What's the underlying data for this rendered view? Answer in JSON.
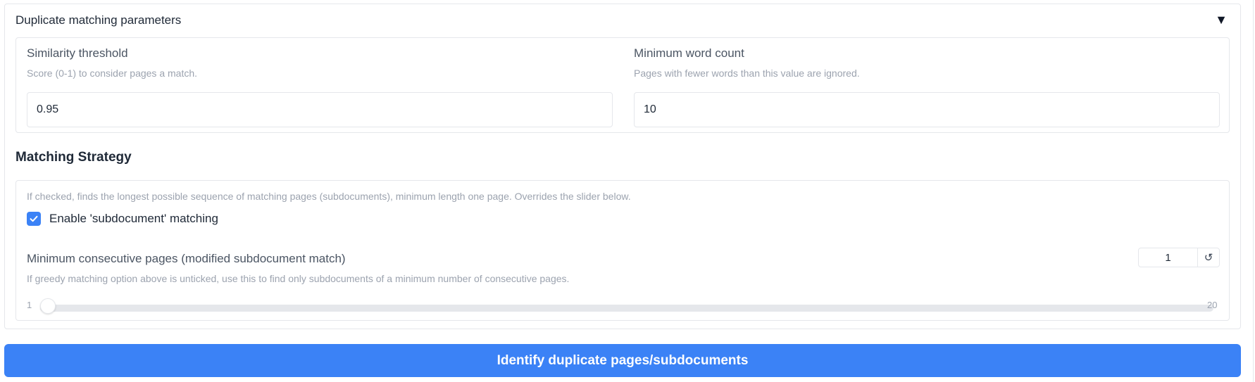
{
  "accordion": {
    "title": "Duplicate matching parameters",
    "toggle_icon": "triangle-down-icon"
  },
  "similarity": {
    "label": "Similarity threshold",
    "info": "Score (0-1) to consider pages a match.",
    "value": "0.95"
  },
  "word_count": {
    "label": "Minimum word count",
    "info": "Pages with fewer words than this value are ignored.",
    "value": "10"
  },
  "strategy": {
    "heading": "Matching Strategy",
    "info": "If checked, finds the longest possible sequence of matching pages (subdocuments), minimum length one page. Overrides the slider below.",
    "checkbox_label": "Enable 'subdocument' matching",
    "checkbox_checked": true
  },
  "consecutive": {
    "label": "Minimum consecutive pages (modified subdocument match)",
    "info": "If greedy matching option above is unticked, use this to find only subdocuments of a minimum number of consecutive pages.",
    "value": "1",
    "min": "1",
    "max": "20",
    "reset_icon": "reset-icon"
  },
  "submit": {
    "label": "Identify duplicate pages/subdocuments"
  },
  "colors": {
    "accent": "#3b82f6",
    "border": "#e5e7eb",
    "muted_text": "#9ca3af"
  }
}
